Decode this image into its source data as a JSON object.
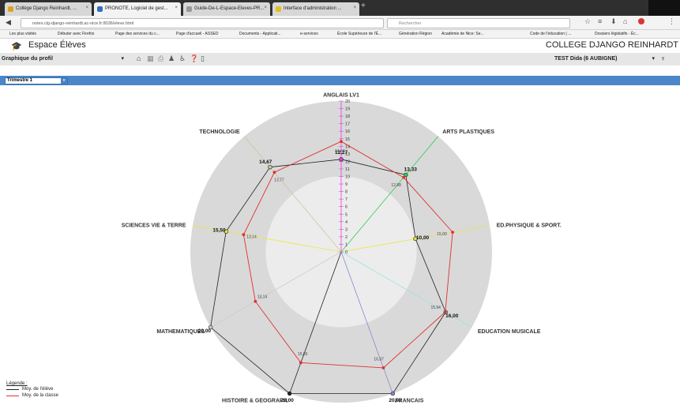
{
  "browser": {
    "tabs": [
      {
        "label": "Collège Django Reinhardt, ...",
        "active": false,
        "color": "#e0a020"
      },
      {
        "label": "PRONOTE, Logiciel de gest...",
        "active": true,
        "color": "#2e6fbf"
      },
      {
        "label": "Guide-De-L-Espace-Eleves-PR...",
        "active": false,
        "color": "#999999"
      },
      {
        "label": "Interface d'administration ...",
        "active": false,
        "color": "#e0c020"
      }
    ],
    "url": "notes.clg-django-reinhardt.ac-nice.fr:8036/eleve.html",
    "search_placeholder": "Rechercher",
    "bookmarks": [
      "Les plus visités",
      "Débuter avec Firefox",
      "Page des services du c...",
      "Page d'accueil - ASSED",
      "Documents - Applicati...",
      "e-services",
      "École Supérieure de l'É...",
      "Génération Région",
      "Académie de Nice: Se...",
      "Code de l'éducation | ...",
      "Dossiers législatifs - Éc..."
    ]
  },
  "app": {
    "title": "Espace Élèves",
    "school": "COLLEGE DJANGO REINHARDT",
    "view_select": "Graphique du profil",
    "student_select": "TEST Dida (6 AUBIGNE)",
    "period_select": "Trimestre 1"
  },
  "legend": {
    "title": "Légende :",
    "student": "Moy. de l'élève",
    "class": "Moy. de la classe"
  },
  "chart_data": {
    "type": "radar",
    "scale": {
      "min": 0,
      "max": 20,
      "ticks": [
        0,
        1,
        2,
        3,
        4,
        5,
        6,
        7,
        8,
        9,
        10,
        11,
        12,
        13,
        14,
        15,
        16,
        17,
        18,
        19,
        20
      ]
    },
    "axes": [
      {
        "name": "ANGLAIS LV1",
        "color": "#e040e0"
      },
      {
        "name": "ARTS PLASTIQUES",
        "color": "#33cc55"
      },
      {
        "name": "ED.PHYSIQUE & SPORT.",
        "color": "#e8e840"
      },
      {
        "name": "EDUCATION MUSICALE",
        "color": "#a0e0e0"
      },
      {
        "name": "FRANCAIS",
        "color": "#8888cc"
      },
      {
        "name": "HISTOIRE & GEOGRAPHIE",
        "color": "#222222"
      },
      {
        "name": "MATHEMATIQUES",
        "color": "#cccccc"
      },
      {
        "name": "SCIENCES VIE & TERRE",
        "color": "#e8e840"
      },
      {
        "name": "TECHNOLOGIE",
        "color": "#c8c8a0"
      }
    ],
    "axis_labels": [
      "ANGLAIS LV1",
      "ARTS PLASTIQUES",
      "ED.PHYSIQUE & SPORT.",
      "EDUCATION MUSICALE",
      "FRANCAIS",
      "HISTOIRE & GEOGRAPH",
      "MATHEMATIQUES",
      "SCIENCES VIE & TERRE",
      "TECHNOLOGIE"
    ],
    "series": [
      {
        "name": "Moy. de l'élève",
        "color": "#222222",
        "values": [
          12.27,
          13.33,
          10.0,
          16.0,
          20.0,
          20.0,
          20.0,
          15.5,
          14.67
        ],
        "labels": [
          "12,27",
          "13,33",
          "10,00",
          "16,00",
          "20,00",
          "20,00",
          "20,00",
          "15,50",
          "14,67"
        ]
      },
      {
        "name": "Moy. de la classe",
        "color": "#e03030",
        "values": [
          14.64,
          12.88,
          15.0,
          15.94,
          16.37,
          15.65,
          13.14,
          13.14,
          13.77
        ],
        "labels": [
          "14,64",
          "12,88",
          "15,00",
          "15,94",
          "16,37",
          "15,65",
          "13,14",
          "13,14",
          "13,77"
        ]
      }
    ]
  }
}
